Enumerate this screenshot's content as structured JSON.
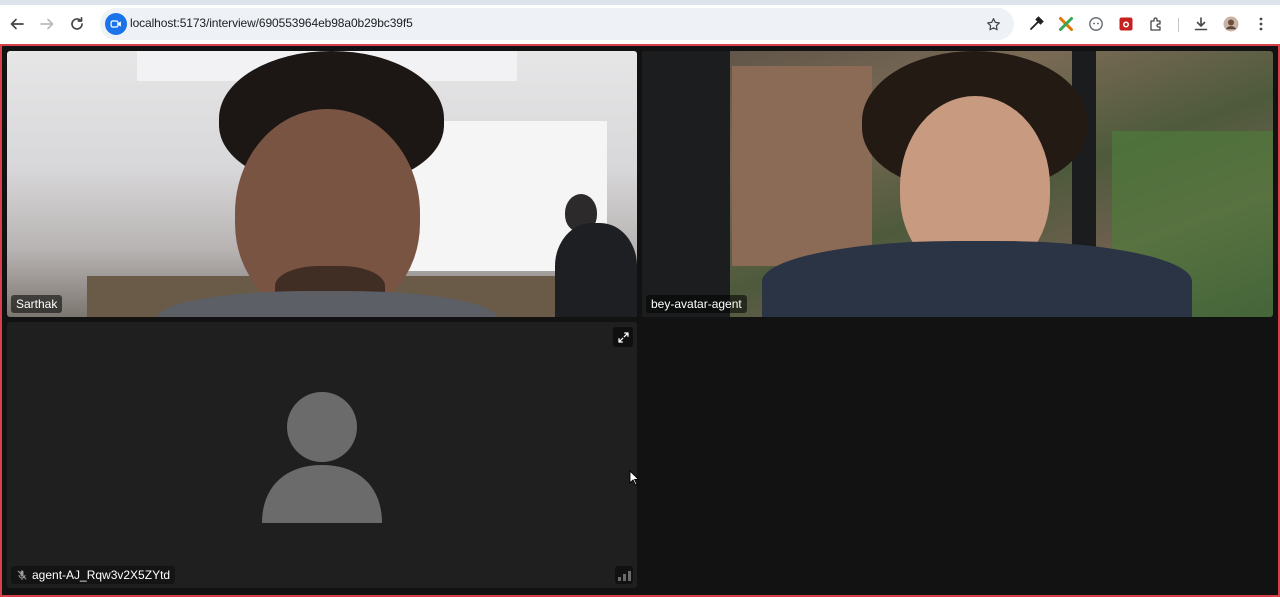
{
  "browser": {
    "url": "localhost:5173/interview/690553964eb98a0b29bc39f5",
    "back_icon": "arrow-left-icon",
    "forward_icon": "arrow-right-icon",
    "reload_icon": "reload-icon",
    "bookmark_icon": "star-icon",
    "extensions": [
      "eyedropper-icon",
      "puzzle-x-icon",
      "face-icon",
      "camera-red-icon",
      "puzzle-icon"
    ],
    "download_icon": "download-icon",
    "menu_icon": "kebab-icon"
  },
  "colors": {
    "accent_border": "#d8404a",
    "app_background": "#121212",
    "tile_background": "#1f1f1f",
    "site_badge": "#1a73e8"
  },
  "participants": [
    {
      "name": "Sarthak",
      "video": true
    },
    {
      "name": "bey-avatar-agent",
      "video": true
    },
    {
      "name": "agent-AJ_Rqw3v2X5ZYtd",
      "video": false,
      "muted": true
    }
  ]
}
